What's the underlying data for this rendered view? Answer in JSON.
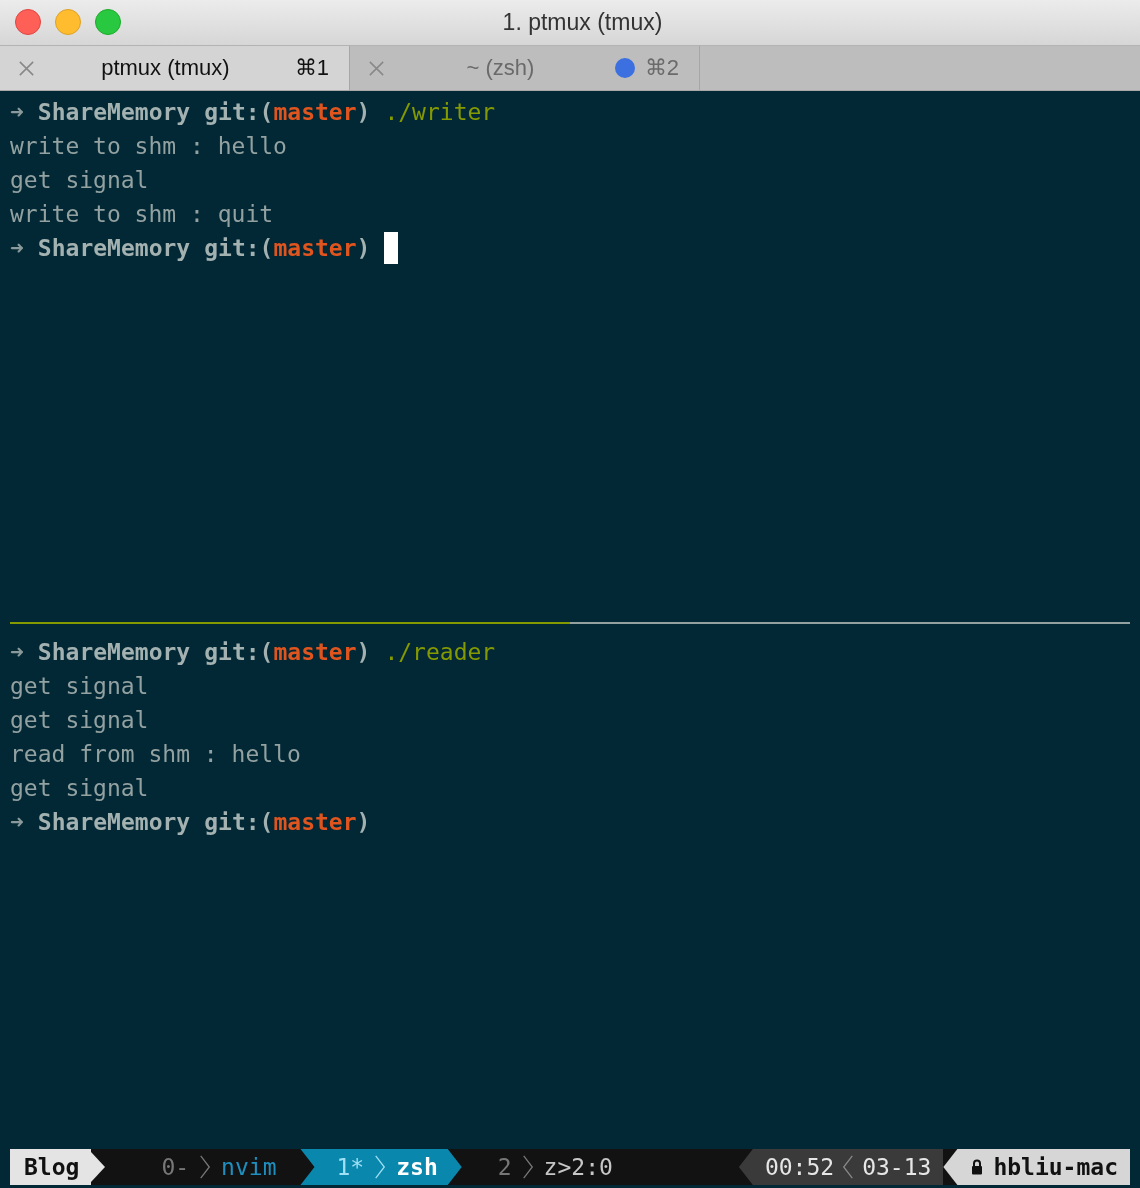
{
  "window": {
    "title": "1. ptmux (tmux)"
  },
  "tabs": [
    {
      "label": "ptmux (tmux)",
      "shortcut": "⌘1",
      "selected": true,
      "activity": false
    },
    {
      "label": "~ (zsh)",
      "shortcut": "⌘2",
      "selected": false,
      "activity": true
    }
  ],
  "panes": [
    {
      "active": true,
      "lines": [
        {
          "kind": "prompt",
          "symbol": "➜",
          "dir": "ShareMemory",
          "git": "git:(",
          "branch": "master",
          "close": ")",
          "command": "./writer",
          "cursor": false
        },
        {
          "kind": "output",
          "text": "write to shm : hello"
        },
        {
          "kind": "output",
          "text": "get signal"
        },
        {
          "kind": "output",
          "text": "write to shm : quit"
        },
        {
          "kind": "prompt",
          "symbol": "➜",
          "dir": "ShareMemory",
          "git": "git:(",
          "branch": "master",
          "close": ")",
          "cursor": true
        }
      ]
    },
    {
      "active": false,
      "lines": [
        {
          "kind": "prompt",
          "symbol": "➜",
          "dir": "ShareMemory",
          "git": "git:(",
          "branch": "master",
          "close": ")",
          "command": "./reader",
          "cursor": false
        },
        {
          "kind": "output",
          "text": "get signal"
        },
        {
          "kind": "output",
          "text": "get signal"
        },
        {
          "kind": "output",
          "text": "read from shm : hello"
        },
        {
          "kind": "output",
          "text": "get signal"
        },
        {
          "kind": "prompt",
          "symbol": "➜",
          "dir": "ShareMemory",
          "git": "git:(",
          "branch": "master",
          "close": ")",
          "cursor": false
        }
      ]
    }
  ],
  "status_bar": {
    "session": "Blog",
    "windows": [
      {
        "index": "0-",
        "name": "nvim",
        "color": "#1e8fbf",
        "selected": false
      },
      {
        "index": "1*",
        "name": "zsh",
        "color": "#ffffff",
        "selected": true
      },
      {
        "index": "2",
        "name": "z>2:0",
        "color": "#c6c6c6",
        "selected": false
      }
    ],
    "time": "00:52",
    "date": "03-13",
    "host": "hbliu-mac"
  }
}
